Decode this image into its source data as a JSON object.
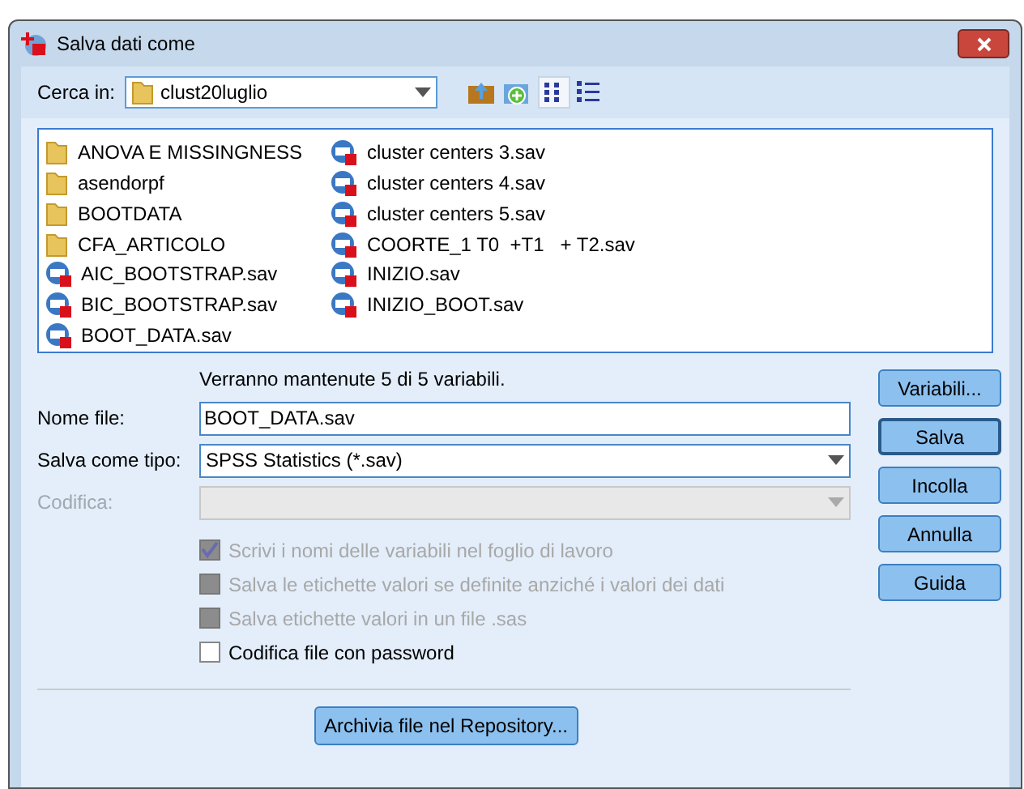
{
  "window": {
    "title": "Salva dati come"
  },
  "look_in": {
    "label": "Cerca in:",
    "value": "clust20luglio"
  },
  "files": [
    {
      "kind": "folder",
      "name": "ANOVA E MISSINGNESS"
    },
    {
      "kind": "folder",
      "name": "asendorpf"
    },
    {
      "kind": "folder",
      "name": "BOOTDATA"
    },
    {
      "kind": "folder",
      "name": "CFA_ARTICOLO"
    },
    {
      "kind": "sav",
      "name": "AIC_BOOTSTRAP.sav"
    },
    {
      "kind": "sav",
      "name": "BIC_BOOTSTRAP.sav"
    },
    {
      "kind": "sav",
      "name": "BOOT_DATA.sav"
    },
    {
      "kind": "sav",
      "name": "cluster centers 3.sav"
    },
    {
      "kind": "sav",
      "name": "cluster centers 4.sav"
    },
    {
      "kind": "sav",
      "name": "cluster centers 5.sav"
    },
    {
      "kind": "sav",
      "name": "COORTE_1 T0  +T1   + T2.sav"
    },
    {
      "kind": "sav",
      "name": "INIZIO.sav"
    },
    {
      "kind": "sav",
      "name": "INIZIO_BOOT.sav"
    }
  ],
  "info": "Verranno mantenute 5 di 5 variabili.",
  "fields": [
    {
      "kind": "text",
      "label": "Nome file:",
      "value": "BOOT_DATA.sav",
      "disabled": false
    },
    {
      "kind": "select",
      "label": "Salva come tipo:",
      "value": "SPSS Statistics (*.sav)",
      "disabled": false
    },
    {
      "kind": "select",
      "label": "Codifica:",
      "disabled": true
    }
  ],
  "options": [
    {
      "label": "Scrivi i nomi delle variabili nel foglio di lavoro",
      "checked": true,
      "disabled": true
    },
    {
      "label": "Salva le etichette valori se definite anziché i valori dei dati",
      "checked": false,
      "disabled": true
    },
    {
      "label": "Salva etichette valori in un file .sas",
      "checked": false,
      "disabled": true
    },
    {
      "label": "Codifica file con password",
      "checked": false,
      "disabled": false
    }
  ],
  "buttons": [
    {
      "label": "Variabili...",
      "default": false
    },
    {
      "label": "Salva",
      "default": true
    },
    {
      "label": "Incolla",
      "default": false
    },
    {
      "label": "Annulla",
      "default": false
    },
    {
      "label": "Guida",
      "default": false
    }
  ],
  "repository_button": "Archivia file nel Repository..."
}
